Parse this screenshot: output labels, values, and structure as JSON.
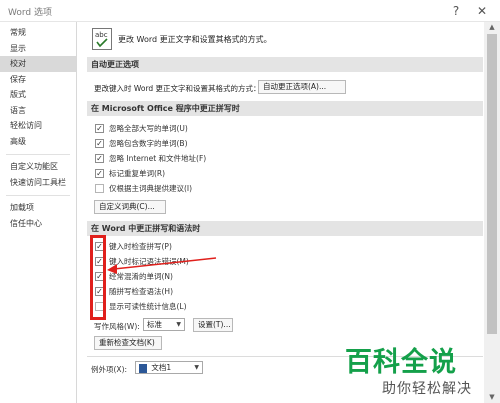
{
  "window": {
    "title": "Word 选项",
    "help_icon": "?",
    "close_icon": "✕"
  },
  "sidebar": {
    "items": [
      {
        "label": "常规"
      },
      {
        "label": "显示"
      },
      {
        "label": "校对",
        "active": true
      },
      {
        "label": "保存"
      },
      {
        "label": "版式"
      },
      {
        "label": "语言"
      },
      {
        "label": "轻松访问"
      },
      {
        "label": "高级"
      },
      {
        "label": "自定义功能区"
      },
      {
        "label": "快速访问工具栏"
      },
      {
        "label": "加载项"
      },
      {
        "label": "信任中心"
      }
    ]
  },
  "main": {
    "intro": {
      "icon": "abc-proofing-icon",
      "icon_text": "abc",
      "text": "更改 Word 更正文字和设置其格式的方式。"
    },
    "autocorrect": {
      "header": "自动更正选项",
      "desc": "更改键入时 Word 更正文字和设置其格式的方式：",
      "button": "自动更正选项(A)..."
    },
    "office": {
      "header": "在 Microsoft Office 程序中更正拼写时",
      "options": [
        {
          "label": "忽略全部大写的单词(U)",
          "checked": true
        },
        {
          "label": "忽略包含数字的单词(B)",
          "checked": true
        },
        {
          "label": "忽略 Internet 和文件地址(F)",
          "checked": true
        },
        {
          "label": "标记重复单词(R)",
          "checked": true
        },
        {
          "label": "仅根据主词典提供建议(I)",
          "checked": false
        }
      ],
      "button": "自定义词典(C)..."
    },
    "word": {
      "header": "在 Word 中更正拼写和语法时",
      "options": [
        {
          "label": "键入时检查拼写(P)",
          "checked": true
        },
        {
          "label": "键入时标记语法错误(M)",
          "checked": true
        },
        {
          "label": "经常混淆的单词(N)",
          "checked": true
        },
        {
          "label": "随拼写检查语法(H)",
          "checked": true
        },
        {
          "label": "显示可读性统计信息(L)",
          "checked": false
        }
      ],
      "style_label": "写作风格(W):",
      "style_value": "标准",
      "settings_button": "设置(T)...",
      "recheck_button": "重新检查文档(K)"
    },
    "exceptions": {
      "label": "例外项(X):",
      "doc_value": "文档1"
    }
  },
  "watermark": {
    "logo": "百科全说",
    "tagline": "助你轻松解决"
  },
  "colors": {
    "annotation_red": "#e0201c",
    "watermark_green": "#14a04a",
    "section_bg": "#e4e4e4"
  }
}
